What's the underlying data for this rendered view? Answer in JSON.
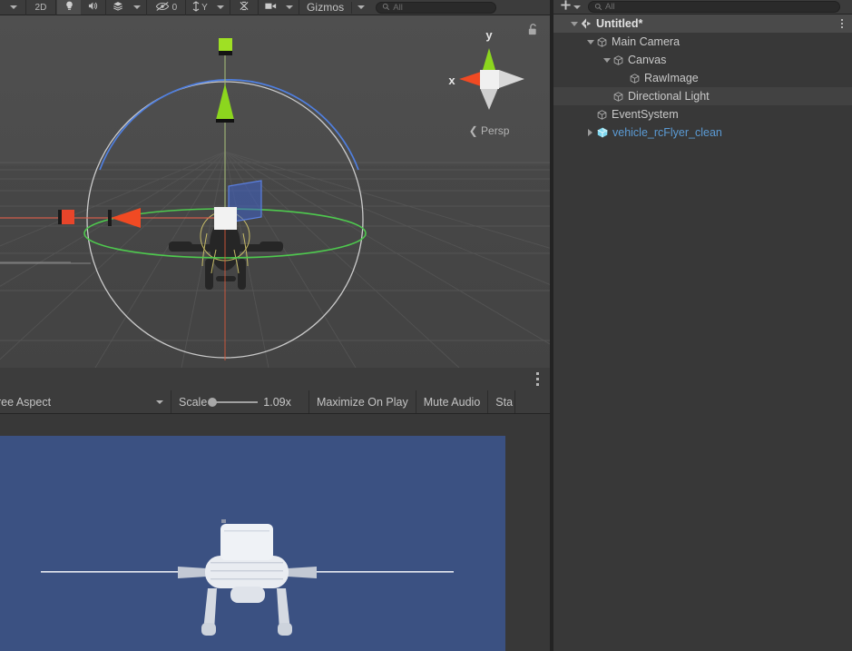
{
  "scene_toolbar": {
    "view_caret": "chevron-down",
    "mode_2d": "2D",
    "lighting_icon": "lightbulb-icon",
    "audio_icon": "speaker-icon",
    "fx_icon": "layers-icon",
    "fx_caret": "chevron-down",
    "hidden_objects_icon": "eye-crossed-icon",
    "hidden_objects_count": "0",
    "grid_axis_icon": "grid-y-icon",
    "grid_axis_label": "Y",
    "grid_caret": "chevron-down",
    "snap_icon": "snap-increment-icon",
    "camera_icon": "scene-camera-icon",
    "camera_caret": "chevron-down",
    "gizmos_label": "Gizmos",
    "gizmos_caret": "chevron-down",
    "search_icon": "search-icon",
    "search_placeholder": "All",
    "search_value": ""
  },
  "scene_view": {
    "gizmo": {
      "axis_y_label": "y",
      "axis_x_label": "x",
      "projection_label": "Persp",
      "projection_arrow": "❮",
      "lock_icon": "padlock-open-icon",
      "color_x": "#f04a23",
      "color_y": "#8cd61e",
      "color_z": "#d8d8d8",
      "center_color": "#f2f2f2"
    },
    "background": "#4b4b4b",
    "grid_color": "#5c5c5c",
    "handles": {
      "move_x_color": "#f04a23",
      "move_y_color": "#8cd61e",
      "plane_xz_color": "#3f63c8",
      "rotate_green": "#4ec94e",
      "rotate_blue": "#4f7fe0",
      "rotate_outline": "#d9d9d9",
      "selection_outline": "#cfc36a"
    }
  },
  "game_toolbar": {
    "kebab_icon": "more-options-icon",
    "aspect_label": "ree Aspect",
    "aspect_caret": "chevron-down",
    "scale_label": "Scale",
    "scale_value": "1.09x",
    "maximize_label": "Maximize On Play",
    "mute_label": "Mute Audio",
    "stats_label": "Sta"
  },
  "game_view": {
    "background_color": "#3b5182",
    "vehicle_color": "#e9ecf1"
  },
  "hierarchy": {
    "toolbar": {
      "add_icon": "plus-icon",
      "add_caret": "chevron-down",
      "search_icon": "search-icon",
      "search_placeholder": "All",
      "search_value": ""
    },
    "rows": [
      {
        "label": "Untitled*",
        "icon": "unity-scene-icon",
        "depth": 0,
        "foldout": "down",
        "kind": "scene",
        "kebab": "more-options-icon"
      },
      {
        "label": "Main Camera",
        "icon": "gameobject-cube-icon",
        "depth": 1,
        "foldout": "down",
        "kind": "gameobject"
      },
      {
        "label": "Canvas",
        "icon": "gameobject-cube-icon",
        "depth": 2,
        "foldout": "down",
        "kind": "gameobject"
      },
      {
        "label": "RawImage",
        "icon": "gameobject-cube-icon",
        "depth": 3,
        "foldout": "none",
        "kind": "gameobject"
      },
      {
        "label": "Directional Light",
        "icon": "gameobject-cube-icon",
        "depth": 2,
        "foldout": "none",
        "kind": "gameobject",
        "hovered": true
      },
      {
        "label": "EventSystem",
        "icon": "gameobject-cube-icon",
        "depth": 1,
        "foldout": "none",
        "kind": "gameobject"
      },
      {
        "label": "vehicle_rcFlyer_clean",
        "icon": "prefab-icon",
        "depth": 1,
        "foldout": "right",
        "kind": "prefab"
      }
    ]
  },
  "colors": {
    "panel_bg": "#383838",
    "toolbar_bg": "#3c3c3c",
    "scene_row_bg": "#4a4a4a",
    "hover_bg": "#424242",
    "prefab_blue": "#5b9bd5",
    "text": "#c9c9c9",
    "divider": "#232323"
  }
}
